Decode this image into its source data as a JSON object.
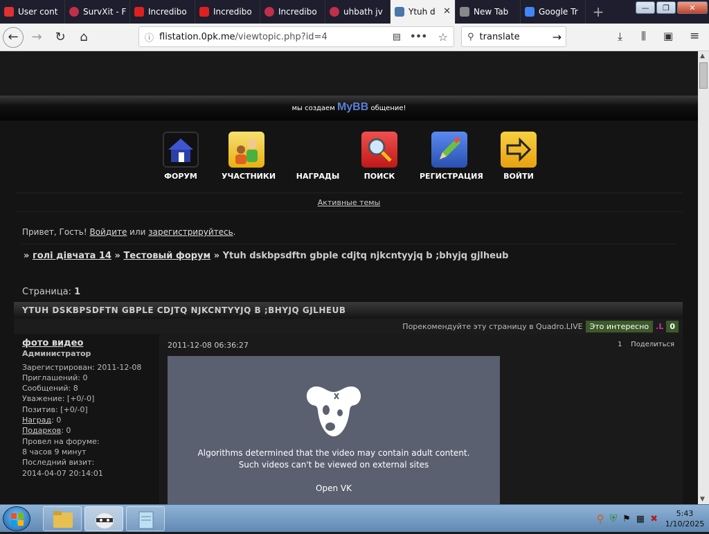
{
  "browser": {
    "tabs": [
      {
        "label": "User cont",
        "color": "#e03030"
      },
      {
        "label": "SurvXit - F",
        "color": "#c0304a"
      },
      {
        "label": "Incredibo",
        "color": "#e02020"
      },
      {
        "label": "Incredibo",
        "color": "#e02020"
      },
      {
        "label": "Incredibo",
        "color": "#c0304a"
      },
      {
        "label": "uhbath jv",
        "color": "#c0304a"
      },
      {
        "label": "Ytuh d",
        "color": "#4a76a8"
      },
      {
        "label": "New Tab",
        "color": "#888888"
      },
      {
        "label": "Google Tr",
        "color": "#4285f4"
      }
    ],
    "url_host": "flistation.0pk.me",
    "url_path": "/viewtopic.php?id=4",
    "search_value": "translate",
    "minimize": "—",
    "maximize": "❐",
    "close": "✕"
  },
  "forum": {
    "banner_left": "мы создаем",
    "banner_brand": "MyBB",
    "banner_right": "общение!",
    "menu": [
      {
        "label": "ФОРУМ",
        "color": "#1f1f6b"
      },
      {
        "label": "УЧАСТНИКИ",
        "color": "#f0c020"
      },
      {
        "label": "НАГРАДЫ",
        "color": "#141414"
      },
      {
        "label": "ПОИСК",
        "color": "#e03030"
      },
      {
        "label": "РЕГИСТРАЦИЯ",
        "color": "#3a6ad0"
      },
      {
        "label": "ВОЙТИ",
        "color": "#f0b020"
      }
    ],
    "active_topics": "Активные темы",
    "greeting_prefix": "Привет, Гость!",
    "login_link": "Войдите",
    "greeting_or": "или",
    "register_link": "зарегистрируйтесь",
    "breadcrumb": {
      "sep": "»",
      "item1": "голі дівчата 14",
      "item2": "Тестовый форум",
      "current": "Ytuh dskbpsdftn gbple cdjtq njkcntyyjq b ;bhyjq gjlheub"
    },
    "page_label": "Страница:",
    "page_number": "1",
    "topic_title": "YTUH DSKBPSDFTN GBPLE CDJTQ NJKCNTYYJQ B ;BHYJQ GJLHEUB",
    "recommend_text": "Порекомендуйте эту страницу в Quadro.LIVE",
    "interest_button": "Это интересно",
    "like_count": "0"
  },
  "post": {
    "author": "фото видео",
    "rank": "Администратор",
    "registered": "Зарегистрирован: 2011-12-08",
    "invites": "Приглашений: 0",
    "messages": "Сообщений: 8",
    "respect": "Уважение: [+0/-0]",
    "positive": "Позитив: [+0/-0]",
    "awards_label": "Наград",
    "awards_value": ": 0",
    "gifts_label": "Подарков",
    "gifts_value": ": 0",
    "time_label": "Провел на форуме:",
    "time_value": "8 часов 9 минут",
    "last_visit_label": "Последний визит:",
    "last_visit_value": "2014-04-07 20:14:01",
    "date": "2011-12-08 06:36:27",
    "number": "1",
    "share": "Поделиться",
    "video_message": "Algorithms determined that the video may contain adult content. Such videos can't be viewed on external sites",
    "video_open": "Open VK"
  },
  "taskbar": {
    "time": "5:43",
    "date": "1/10/2025"
  }
}
